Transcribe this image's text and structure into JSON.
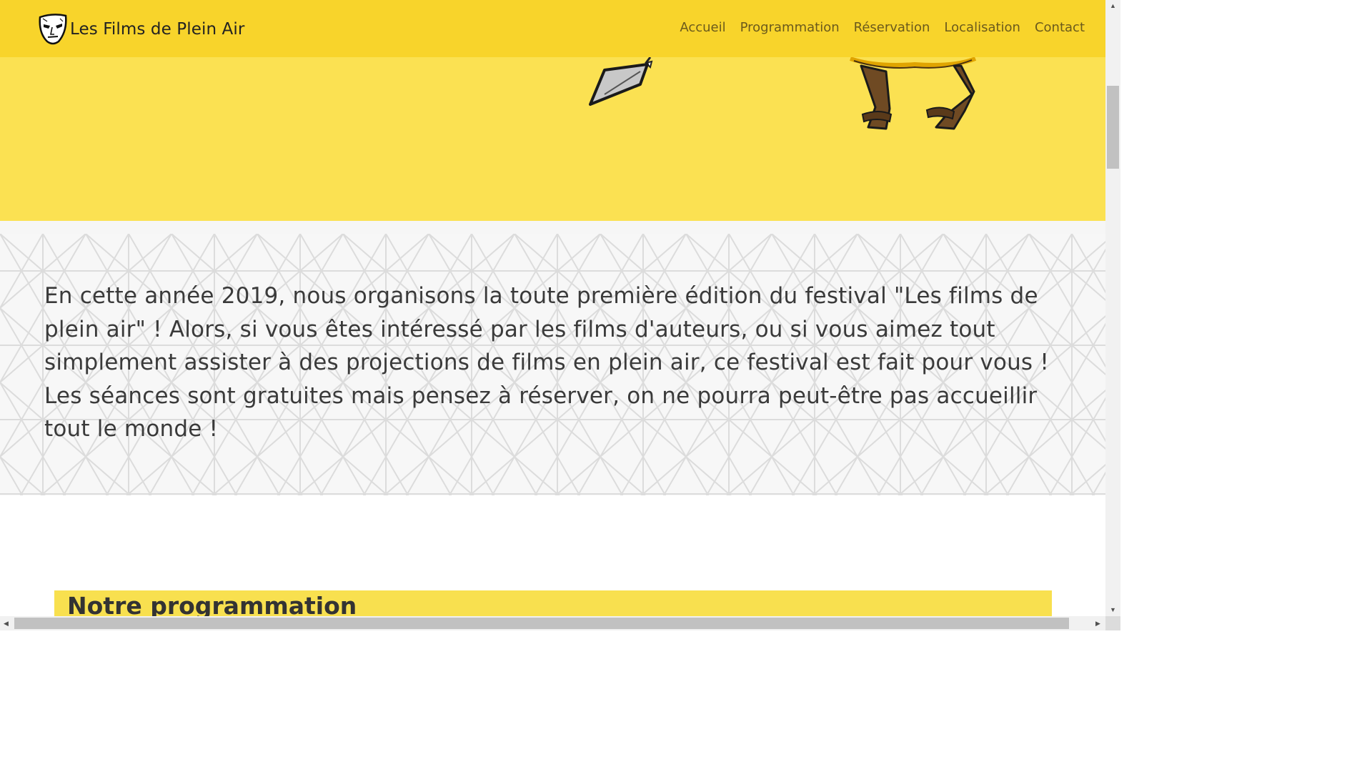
{
  "brand": {
    "title": "Les Films de Plein Air",
    "logo_icon": "mask-icon"
  },
  "nav": {
    "items": [
      {
        "label": "Accueil"
      },
      {
        "label": "Programmation"
      },
      {
        "label": "Réservation"
      },
      {
        "label": "Localisation"
      },
      {
        "label": "Contact"
      }
    ]
  },
  "hero": {
    "illustrations": [
      "spear-tip-icon",
      "character-legs-icon"
    ]
  },
  "intro": {
    "text": "En cette année 2019, nous organisons la toute première édition du festival \"Les films de plein air\" ! Alors, si vous êtes intéressé par les films d'auteurs, ou si vous aimez tout simplement assister à des projections de films en plein air, ce festival est fait pour vous ! Les séances sont gratuites mais pensez à réserver, on ne pourra peut-être pas accueillir tout le monde !"
  },
  "programme": {
    "title": "Notre programmation"
  },
  "colors": {
    "navbar": "#f8d42b",
    "hero": "#fbe152",
    "section_heading": "#f8e04f",
    "nav_text": "#6b5a1c"
  }
}
